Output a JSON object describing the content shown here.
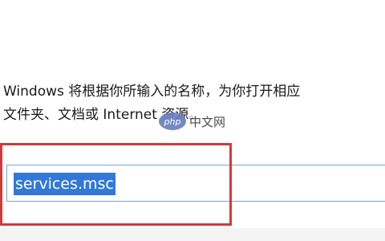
{
  "run_dialog": {
    "prompt_line1": "Windows 将根据你所输入的名称，为你打开相应",
    "prompt_line2": "文件夹、文档或 Internet 资源。",
    "open_input_value": "services.msc"
  },
  "watermark": {
    "logo_text": "php",
    "site_text": "中文网"
  },
  "colors": {
    "highlight_box": "#d23a3a",
    "selection": "#3278d8",
    "input_border": "#7aa4d8"
  }
}
